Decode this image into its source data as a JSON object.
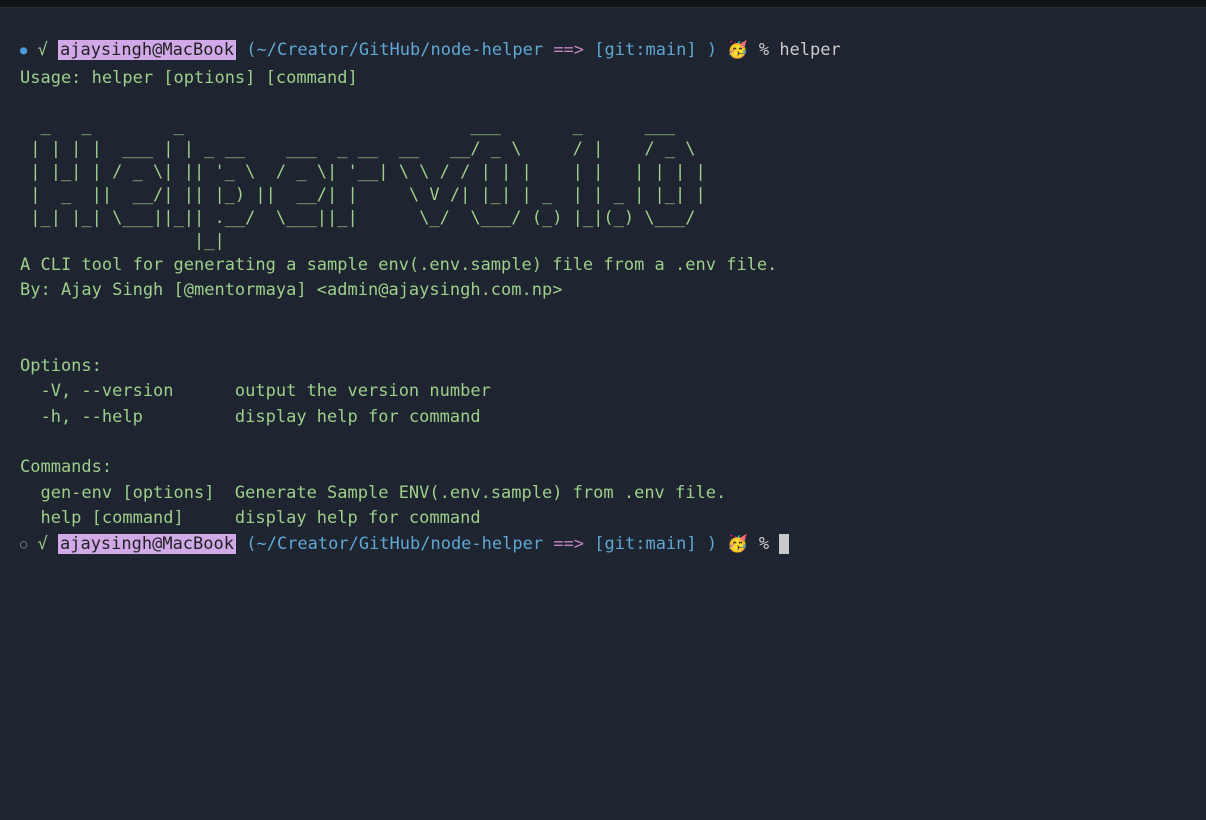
{
  "prompt1": {
    "dot": "●",
    "check": "√",
    "user_host": "ajaysingh@MacBook",
    "paren_open": "(",
    "path": "~/Creator/GitHub/node-helper",
    "arrow": "==>",
    "git": "[git:main]",
    "paren_close": ")",
    "emoji": "🥳",
    "pct": "%",
    "command": "helper"
  },
  "usage_line": "Usage: helper [options] [command]",
  "ascii_art": "  _   _        _                            ___       _      ___  \n | | | |  ___ | | _ __    ___  _ __  __   __/ _ \\     / |    / _ \\ \n | |_| | / _ \\| || '_ \\  / _ \\| '__| \\ \\ / / | | |    | |   | | | |\n |  _  ||  __/| || |_) ||  __/| |     \\ V /| |_| | _  | | _ | |_| |\n |_| |_| \\___||_|| .__/  \\___||_|      \\_/  \\___/ (_) |_|(_) \\___/ \n                 |_|                                               ",
  "description": "A CLI tool for generating a sample env(.env.sample) file from a .env file.",
  "author_line": "By: Ajay Singh [@mentormaya] <admin@ajaysingh.com.np>",
  "options_header": "Options:",
  "option_version": "  -V, --version      output the version number",
  "option_help": "  -h, --help         display help for command",
  "commands_header": "Commands:",
  "command_genenv": "  gen-env [options]  Generate Sample ENV(.env.sample) from .env file.",
  "command_help": "  help [command]     display help for command",
  "prompt2": {
    "dot": "○",
    "check": "√",
    "user_host": "ajaysingh@MacBook",
    "paren_open": "(",
    "path": "~/Creator/GitHub/node-helper",
    "arrow": "==>",
    "git": "[git:main]",
    "paren_close": ")",
    "emoji": "🥳",
    "pct": "%"
  }
}
